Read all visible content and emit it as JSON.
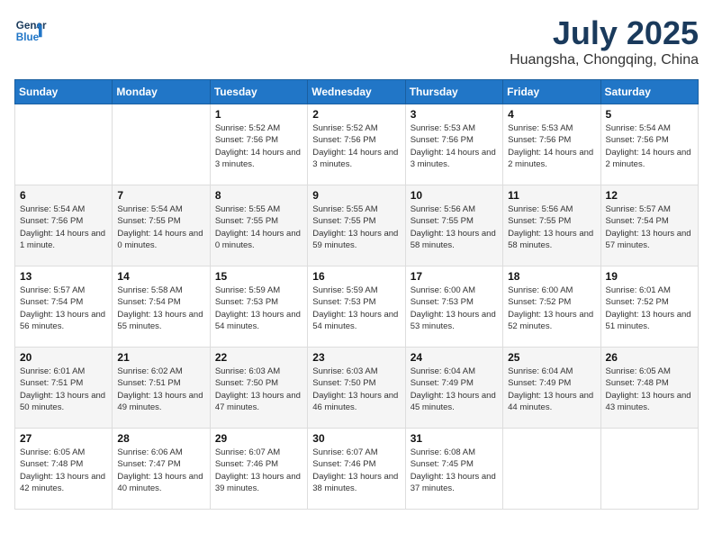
{
  "header": {
    "logo_line1": "General",
    "logo_line2": "Blue",
    "month_year": "July 2025",
    "location": "Huangsha, Chongqing, China"
  },
  "weekdays": [
    "Sunday",
    "Monday",
    "Tuesday",
    "Wednesday",
    "Thursday",
    "Friday",
    "Saturday"
  ],
  "weeks": [
    [
      {
        "day": "",
        "info": ""
      },
      {
        "day": "",
        "info": ""
      },
      {
        "day": "1",
        "info": "Sunrise: 5:52 AM\nSunset: 7:56 PM\nDaylight: 14 hours and 3 minutes."
      },
      {
        "day": "2",
        "info": "Sunrise: 5:52 AM\nSunset: 7:56 PM\nDaylight: 14 hours and 3 minutes."
      },
      {
        "day": "3",
        "info": "Sunrise: 5:53 AM\nSunset: 7:56 PM\nDaylight: 14 hours and 3 minutes."
      },
      {
        "day": "4",
        "info": "Sunrise: 5:53 AM\nSunset: 7:56 PM\nDaylight: 14 hours and 2 minutes."
      },
      {
        "day": "5",
        "info": "Sunrise: 5:54 AM\nSunset: 7:56 PM\nDaylight: 14 hours and 2 minutes."
      }
    ],
    [
      {
        "day": "6",
        "info": "Sunrise: 5:54 AM\nSunset: 7:56 PM\nDaylight: 14 hours and 1 minute."
      },
      {
        "day": "7",
        "info": "Sunrise: 5:54 AM\nSunset: 7:55 PM\nDaylight: 14 hours and 0 minutes."
      },
      {
        "day": "8",
        "info": "Sunrise: 5:55 AM\nSunset: 7:55 PM\nDaylight: 14 hours and 0 minutes."
      },
      {
        "day": "9",
        "info": "Sunrise: 5:55 AM\nSunset: 7:55 PM\nDaylight: 13 hours and 59 minutes."
      },
      {
        "day": "10",
        "info": "Sunrise: 5:56 AM\nSunset: 7:55 PM\nDaylight: 13 hours and 58 minutes."
      },
      {
        "day": "11",
        "info": "Sunrise: 5:56 AM\nSunset: 7:55 PM\nDaylight: 13 hours and 58 minutes."
      },
      {
        "day": "12",
        "info": "Sunrise: 5:57 AM\nSunset: 7:54 PM\nDaylight: 13 hours and 57 minutes."
      }
    ],
    [
      {
        "day": "13",
        "info": "Sunrise: 5:57 AM\nSunset: 7:54 PM\nDaylight: 13 hours and 56 minutes."
      },
      {
        "day": "14",
        "info": "Sunrise: 5:58 AM\nSunset: 7:54 PM\nDaylight: 13 hours and 55 minutes."
      },
      {
        "day": "15",
        "info": "Sunrise: 5:59 AM\nSunset: 7:53 PM\nDaylight: 13 hours and 54 minutes."
      },
      {
        "day": "16",
        "info": "Sunrise: 5:59 AM\nSunset: 7:53 PM\nDaylight: 13 hours and 54 minutes."
      },
      {
        "day": "17",
        "info": "Sunrise: 6:00 AM\nSunset: 7:53 PM\nDaylight: 13 hours and 53 minutes."
      },
      {
        "day": "18",
        "info": "Sunrise: 6:00 AM\nSunset: 7:52 PM\nDaylight: 13 hours and 52 minutes."
      },
      {
        "day": "19",
        "info": "Sunrise: 6:01 AM\nSunset: 7:52 PM\nDaylight: 13 hours and 51 minutes."
      }
    ],
    [
      {
        "day": "20",
        "info": "Sunrise: 6:01 AM\nSunset: 7:51 PM\nDaylight: 13 hours and 50 minutes."
      },
      {
        "day": "21",
        "info": "Sunrise: 6:02 AM\nSunset: 7:51 PM\nDaylight: 13 hours and 49 minutes."
      },
      {
        "day": "22",
        "info": "Sunrise: 6:03 AM\nSunset: 7:50 PM\nDaylight: 13 hours and 47 minutes."
      },
      {
        "day": "23",
        "info": "Sunrise: 6:03 AM\nSunset: 7:50 PM\nDaylight: 13 hours and 46 minutes."
      },
      {
        "day": "24",
        "info": "Sunrise: 6:04 AM\nSunset: 7:49 PM\nDaylight: 13 hours and 45 minutes."
      },
      {
        "day": "25",
        "info": "Sunrise: 6:04 AM\nSunset: 7:49 PM\nDaylight: 13 hours and 44 minutes."
      },
      {
        "day": "26",
        "info": "Sunrise: 6:05 AM\nSunset: 7:48 PM\nDaylight: 13 hours and 43 minutes."
      }
    ],
    [
      {
        "day": "27",
        "info": "Sunrise: 6:05 AM\nSunset: 7:48 PM\nDaylight: 13 hours and 42 minutes."
      },
      {
        "day": "28",
        "info": "Sunrise: 6:06 AM\nSunset: 7:47 PM\nDaylight: 13 hours and 40 minutes."
      },
      {
        "day": "29",
        "info": "Sunrise: 6:07 AM\nSunset: 7:46 PM\nDaylight: 13 hours and 39 minutes."
      },
      {
        "day": "30",
        "info": "Sunrise: 6:07 AM\nSunset: 7:46 PM\nDaylight: 13 hours and 38 minutes."
      },
      {
        "day": "31",
        "info": "Sunrise: 6:08 AM\nSunset: 7:45 PM\nDaylight: 13 hours and 37 minutes."
      },
      {
        "day": "",
        "info": ""
      },
      {
        "day": "",
        "info": ""
      }
    ]
  ]
}
